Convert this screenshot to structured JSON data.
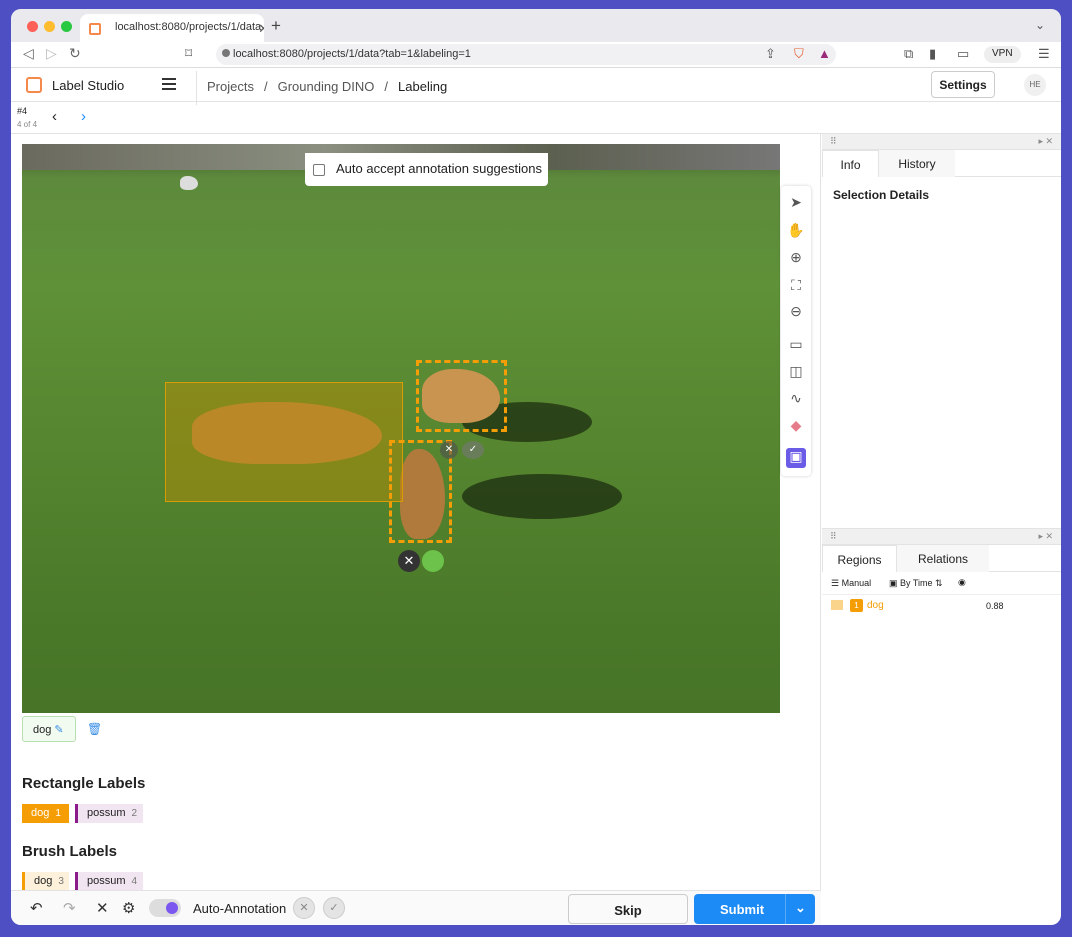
{
  "browser": {
    "tab_title": "localhost:8080/projects/1/data",
    "url": "localhost:8080/projects/1/data?tab=1&labeling=1",
    "vpn": "VPN"
  },
  "app": {
    "brand": "Label Studio",
    "crumbs": [
      "Projects",
      "/",
      "Grounding DINO",
      "/",
      "Labeling"
    ],
    "settings": "Settings",
    "avatar": "HE"
  },
  "task": {
    "id": "#4",
    "of": "4 of 4"
  },
  "canvas": {
    "auto_accept": "Auto accept annotation suggestions"
  },
  "region_tag": "dog",
  "rectangle_labels": {
    "title": "Rectangle Labels",
    "items": [
      {
        "label": "dog",
        "key": "1",
        "color": "#f59d05"
      },
      {
        "label": "possum",
        "key": "2",
        "color": "#8b1a8b"
      }
    ]
  },
  "brush_labels": {
    "title": "Brush Labels",
    "items": [
      {
        "label": "dog",
        "key": "3",
        "color": "#f59d05"
      },
      {
        "label": "possum",
        "key": "4",
        "color": "#8b1a8b"
      }
    ]
  },
  "bottom": {
    "auto_annotation": "Auto-Annotation",
    "skip": "Skip",
    "submit": "Submit"
  },
  "info_panel": {
    "tabs": [
      "Info",
      "History"
    ],
    "heading": "Selection Details"
  },
  "regions_panel": {
    "tabs": [
      "Regions",
      "Relations"
    ],
    "manual": "Manual",
    "by_time": "By Time",
    "rows": [
      {
        "index": "1",
        "label": "dog",
        "score": "0.88"
      }
    ]
  }
}
